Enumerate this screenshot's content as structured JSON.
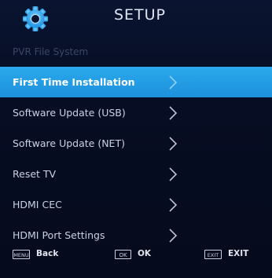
{
  "header": {
    "title": "SETUP",
    "icon": "gear-icon"
  },
  "disabled_item": {
    "label": "PVR File System"
  },
  "menu": {
    "items": [
      {
        "label": "First Time Installation",
        "selected": true
      },
      {
        "label": "Software Update (USB)",
        "selected": false
      },
      {
        "label": "Software Update (NET)",
        "selected": false
      },
      {
        "label": "Reset TV",
        "selected": false
      },
      {
        "label": "HDMI CEC",
        "selected": false
      },
      {
        "label": "HDMI Port Settings",
        "selected": false
      }
    ]
  },
  "footer": {
    "back_key": "MENU",
    "back_label": "Back",
    "ok_key": "OK",
    "ok_label": "OK",
    "exit_key": "EXIT",
    "exit_label": "EXIT"
  },
  "colors": {
    "selected_bg": "#1d90dc",
    "background": "#050a1c",
    "gear": "#2ea9f0"
  }
}
